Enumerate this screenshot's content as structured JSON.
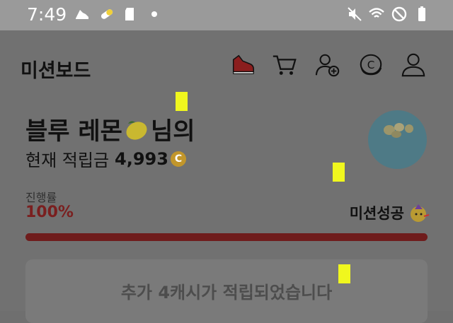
{
  "status_bar": {
    "time": "7:49",
    "left_icons": [
      "running-shoe-icon",
      "pill-icon",
      "sd-card-icon",
      "dot-icon"
    ],
    "right_icons": [
      "mute-icon",
      "wifi-icon",
      "do-not-disturb-icon",
      "battery-icon"
    ]
  },
  "header": {
    "title": "미션보드",
    "icons": [
      "shoe-icon",
      "cart-icon",
      "add-friend-icon",
      "coin-c-icon",
      "profile-icon"
    ]
  },
  "greeting": {
    "name": "블루 레몬",
    "suffix": "님의",
    "balance_label": "현재 적립금",
    "balance_value": "4,993",
    "coin_symbol": "C"
  },
  "progress": {
    "label": "진행률",
    "value_text": "100%",
    "fraction": 1.0,
    "mission_status": "미션성공",
    "bar_color": "#6f1c1c",
    "track_color": "#5a5a5a"
  },
  "notice": {
    "text": "추가 4캐시가 적립되었습니다"
  },
  "colors": {
    "status_bar": "#9a9a9a",
    "background": "#717171",
    "accent_red": "#7a1f1f",
    "coin": "#c2962b",
    "marker": "#f0f71e"
  }
}
